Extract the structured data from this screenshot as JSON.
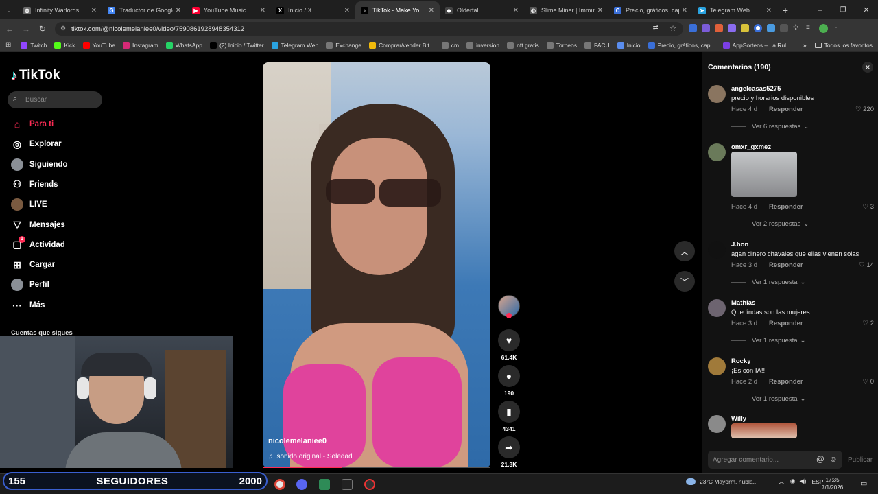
{
  "tabs": [
    {
      "label": "Infinity Warlords",
      "color": "#6a6a6a",
      "glyph": "◍"
    },
    {
      "label": "Traductor de Google",
      "color": "#4285f4",
      "glyph": "G"
    },
    {
      "label": "YouTube Music",
      "color": "#ff0033",
      "glyph": "▶"
    },
    {
      "label": "Inicio / X",
      "color": "#000000",
      "glyph": "X"
    },
    {
      "label": "TikTok - Make Yo",
      "color": "#000000",
      "glyph": "♪",
      "active": true
    },
    {
      "label": "Olderfall",
      "color": "#444444",
      "glyph": "◆"
    },
    {
      "label": "Slime Miner | Immuta",
      "color": "#555555",
      "glyph": "◎"
    },
    {
      "label": "Precio, gráficos, capi",
      "color": "#3a6fd8",
      "glyph": "C"
    },
    {
      "label": "Telegram Web",
      "color": "#2aa3e0",
      "glyph": "➤"
    }
  ],
  "address": {
    "url": "tiktok.com/@nicolemelaniee0/video/7590861928948354312"
  },
  "bookmarks": [
    {
      "label": "Twitch",
      "color": "#9146ff"
    },
    {
      "label": "Kick",
      "color": "#53fc18"
    },
    {
      "label": "YouTube",
      "color": "#ff0000"
    },
    {
      "label": "Instagram",
      "color": "#d62976"
    },
    {
      "label": "WhatsApp",
      "color": "#25d366"
    },
    {
      "label": "(2) Inicio / Twitter",
      "color": "#000000"
    },
    {
      "label": "Telegram Web",
      "color": "#2aa3e0"
    },
    {
      "label": "Exchange",
      "color": "#777777"
    },
    {
      "label": "Comprar/vender Bit...",
      "color": "#f0b90b"
    },
    {
      "label": "cm",
      "color": "#777777"
    },
    {
      "label": "inversion",
      "color": "#777777"
    },
    {
      "label": "nft gratis",
      "color": "#777777"
    },
    {
      "label": "Torneos",
      "color": "#777777"
    },
    {
      "label": "FACU",
      "color": "#777777"
    },
    {
      "label": "Inicio",
      "color": "#5a8dee"
    },
    {
      "label": "Precio, gráficos, cap...",
      "color": "#3a6fd8"
    },
    {
      "label": "AppSorteos – La Rul...",
      "color": "#7b3fe4"
    }
  ],
  "bookmarks_all": "Todos los favoritos",
  "sidebar": {
    "logo": "TikTok",
    "search_placeholder": "Buscar",
    "items": [
      {
        "label": "Para ti",
        "icon": "home-icon",
        "active": true
      },
      {
        "label": "Explorar",
        "icon": "compass-icon"
      },
      {
        "label": "Siguiendo",
        "icon": "following-avatar-icon"
      },
      {
        "label": "Friends",
        "icon": "friends-icon"
      },
      {
        "label": "LIVE",
        "icon": "live-icon"
      },
      {
        "label": "Mensajes",
        "icon": "messages-icon"
      },
      {
        "label": "Actividad",
        "icon": "activity-icon",
        "badge": "1"
      },
      {
        "label": "Cargar",
        "icon": "upload-icon"
      },
      {
        "label": "Perfil",
        "icon": "profile-icon"
      },
      {
        "label": "Más",
        "icon": "more-icon"
      }
    ],
    "following_header": "Cuentas que sigues"
  },
  "video": {
    "username": "nicolemelaniee0",
    "sound": "sonido original - Soledad",
    "progress": 0.35,
    "likes": "61.4K",
    "comments": "190",
    "saves": "4341",
    "shares": "21.3K"
  },
  "comments_panel": {
    "title": "Comentarios (190)",
    "input_placeholder": "Agregar comentario...",
    "post_label": "Publicar",
    "items": [
      {
        "user": "angelcasas5275",
        "text": "precio y horarios disponibles",
        "time": "Hace 4 d",
        "reply": "Responder",
        "likes": "220",
        "more": "Ver 6 respuestas",
        "avatar": "#8a7560"
      },
      {
        "user": "omxr_gxmez",
        "text": "",
        "image": true,
        "time": "Hace 4 d",
        "reply": "Responder",
        "likes": "3",
        "more": "Ver 2 respuestas",
        "avatar": "#6a7a5a"
      },
      {
        "user": "J.hon",
        "text": "agan dinero chavales que ellas vienen solas",
        "time": "Hace 3 d",
        "reply": "Responder",
        "likes": "14",
        "more": "Ver 1 respuesta",
        "avatar": "#111111"
      },
      {
        "user": "Mathias",
        "text": "Que lindas son las mujeres",
        "time": "Hace 3 d",
        "reply": "Responder",
        "likes": "2",
        "more": "Ver 1 respuesta",
        "avatar": "#6d6470"
      },
      {
        "user": "Rocky",
        "text": "¡Es con IA!!",
        "time": "Hace 2 d",
        "reply": "Responder",
        "likes": "0",
        "more": "Ver 1 respuesta",
        "avatar": "#a07a3a"
      },
      {
        "user": "Willy",
        "text": "",
        "image": true,
        "avatar": "#8a8a8a"
      }
    ]
  },
  "overlay": {
    "left": "155",
    "center": "SEGUIDORES",
    "right": "2000"
  },
  "taskbar": {
    "weather": "23°C  Mayorm. nubla...",
    "lang": "ESP",
    "time": "17:35",
    "date": "7/1/2026"
  },
  "colors": {
    "accent": "#fe2c55",
    "bg": "#000000",
    "panel": "#121212"
  }
}
